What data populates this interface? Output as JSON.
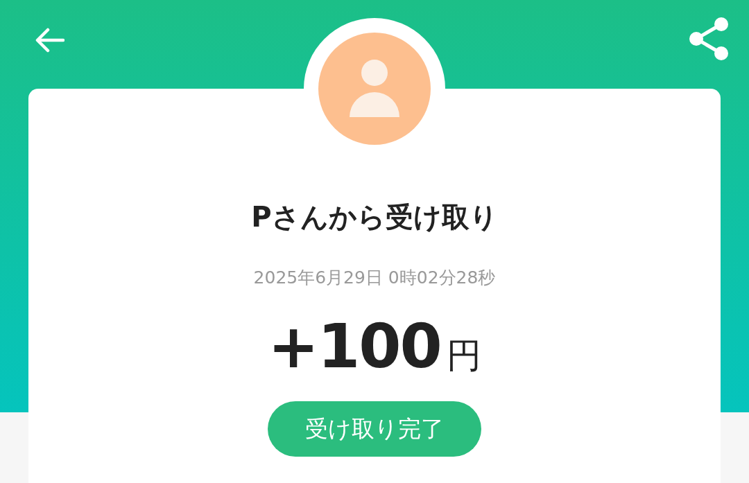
{
  "transfer": {
    "title": "Pさんから受け取り",
    "datetime": "2025年6月29日 0時02分28秒",
    "amount": "+100",
    "currency": "円",
    "status": "受け取り完了"
  }
}
